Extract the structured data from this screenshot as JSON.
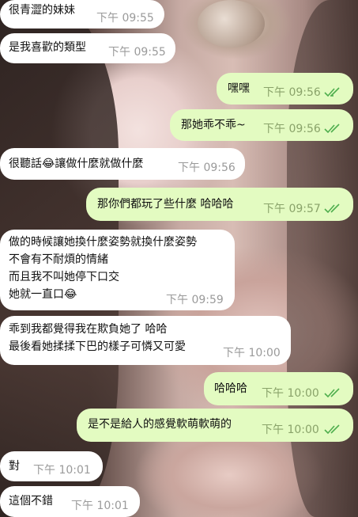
{
  "messages": [
    {
      "dir": "in",
      "text": "很青澀的妹妹",
      "time": "下午 09:55"
    },
    {
      "dir": "in",
      "text": "是我喜歡的類型",
      "time": "下午 09:55"
    },
    {
      "dir": "out",
      "text": "嘿嘿",
      "time": "下午 09:56",
      "read": true
    },
    {
      "dir": "out",
      "text": "那她乖不乖~",
      "time": "下午 09:56",
      "read": true
    },
    {
      "dir": "in",
      "text": "很聽話😂讓做什麼就做什麼",
      "time": "下午 09:56"
    },
    {
      "dir": "out",
      "text": "那你們都玩了些什麼 哈哈哈",
      "time": "下午 09:57",
      "read": true
    },
    {
      "dir": "in",
      "lines": [
        "做的時候讓她換什麼姿勢就換什麼姿勢",
        "不會有不耐煩的情緒",
        "而且我不叫她停下口交",
        "她就一直口😂"
      ],
      "time": "下午 09:59"
    },
    {
      "dir": "in",
      "lines": [
        "乖到我都覺得我在欺負她了 哈哈",
        "最後看她揉揉下巴的樣子可憐又可愛"
      ],
      "time": "下午 10:00"
    },
    {
      "dir": "out",
      "text": "哈哈哈",
      "time": "下午 10:00",
      "read": true
    },
    {
      "dir": "out",
      "text": "是不是給人的感覺軟萌軟萌的",
      "time": "下午 10:00",
      "read": true
    },
    {
      "dir": "in",
      "text": "對",
      "time": "下午 10:01"
    },
    {
      "dir": "in",
      "text": "這個不錯",
      "time": "下午 10:01"
    }
  ],
  "colors": {
    "incoming": "#ffffff",
    "outgoing": "#e3fbc1",
    "read_check": "#4fae4e"
  },
  "icons": {
    "read_receipt": "double-check-icon"
  }
}
